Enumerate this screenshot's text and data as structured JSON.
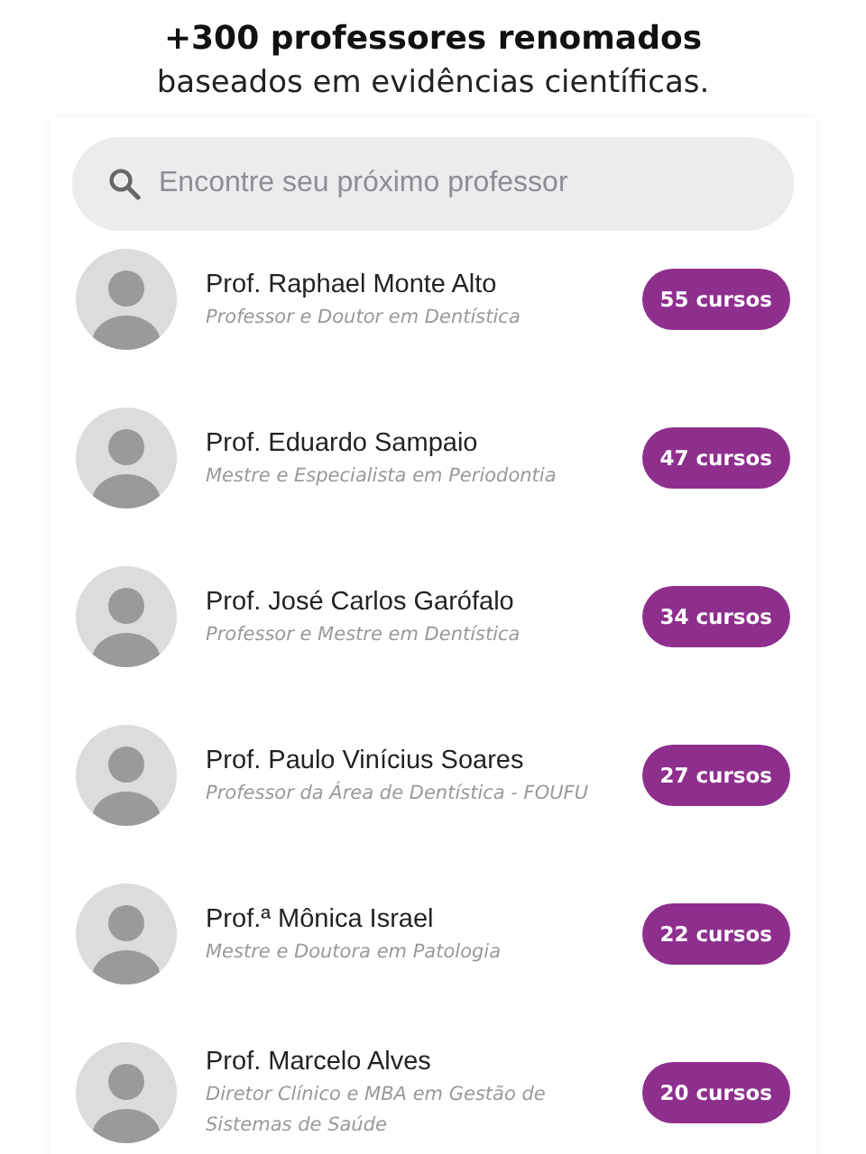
{
  "header": {
    "title": "+300 professores renomados",
    "subtitle": "baseados em evidências científicas."
  },
  "search": {
    "placeholder": "Encontre seu próximo professor"
  },
  "professors": [
    {
      "name": "Prof. Raphael Monte Alto",
      "title": "Professor e Doutor em Dentística",
      "courses": "55 cursos"
    },
    {
      "name": "Prof. Eduardo Sampaio",
      "title": "Mestre e Especialista em Periodontia",
      "courses": "47 cursos"
    },
    {
      "name": "Prof. José Carlos Garófalo",
      "title": "Professor e Mestre em Dentística",
      "courses": "34 cursos"
    },
    {
      "name": "Prof. Paulo Vinícius Soares",
      "title": "Professor da Área de Dentística - FOUFU",
      "courses": "27 cursos"
    },
    {
      "name": "Prof.ª Mônica Israel",
      "title": "Mestre e Doutora em Patologia",
      "courses": "22 cursos"
    },
    {
      "name": "Prof. Marcelo Alves",
      "title": "Diretor Clínico e MBA em Gestão de Sistemas de Saúde",
      "courses": "20 cursos"
    }
  ]
}
